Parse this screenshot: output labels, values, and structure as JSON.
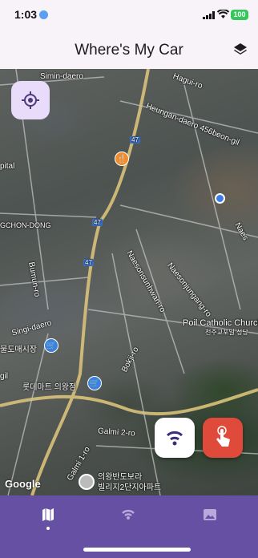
{
  "status_bar": {
    "time": "1:03",
    "battery": "100"
  },
  "app_bar": {
    "title": "Where's My Car",
    "action_icon": "layers-icon"
  },
  "map": {
    "labels": [
      {
        "text": "Simin-daero",
        "name": "street-label-simin-daero"
      },
      {
        "text": "Hagui-ro",
        "name": "street-label-hagui-ro"
      },
      {
        "text": "Heungan-daero 456beon-gil",
        "name": "street-label-heungan-daero"
      },
      {
        "text": "pital",
        "name": "place-label-hospital"
      },
      {
        "text": "GCHON-DONG",
        "name": "area-label-gchon-dong"
      },
      {
        "text": "Naesonjungang-ro",
        "name": "street-label-naesonjungang-ro"
      },
      {
        "text": "Naesonsunhwan-ro",
        "name": "street-label-naesonsunhwan-ro"
      },
      {
        "text": "Bumun-ro",
        "name": "street-label-bumun-ro"
      },
      {
        "text": "Singi-daero",
        "name": "street-label-singi-daero"
      },
      {
        "text": "Poil Catholic Church",
        "name": "place-label-poil-catholic-church"
      },
      {
        "text": "천주교포일 성당",
        "name": "place-label-church-korean"
      },
      {
        "text": "물도매시장",
        "name": "place-label-wholesale-market"
      },
      {
        "text": "롯데마트 의왕점",
        "name": "place-label-lotte-mart"
      },
      {
        "text": "Bokji-ro",
        "name": "street-label-bokji-ro"
      },
      {
        "text": "Galmi 2-ro",
        "name": "street-label-galmi-2-ro"
      },
      {
        "text": "Galmi 1-ro",
        "name": "street-label-galmi-1-ro"
      },
      {
        "text": "의왕반도보라",
        "name": "place-label-apartment-line1"
      },
      {
        "text": "빌리지2단지아파트",
        "name": "place-label-apartment-line2"
      },
      {
        "text": "Naes",
        "name": "street-label-naes"
      },
      {
        "text": "gil",
        "name": "street-label-gil"
      },
      {
        "text": "47",
        "name": "route-shield-47-a"
      },
      {
        "text": "47",
        "name": "route-shield-47-b"
      },
      {
        "text": "47",
        "name": "route-shield-47-c"
      }
    ],
    "attribution": "Google",
    "pins": [
      {
        "name": "restaurant-pin",
        "icon": "fork-knife-icon",
        "color": "#f28b2a"
      },
      {
        "name": "shopping-pin-market",
        "icon": "cart-icon",
        "color": "#3b82e0"
      },
      {
        "name": "shopping-pin-lotte",
        "icon": "cart-icon",
        "color": "#3b82e0"
      },
      {
        "name": "user-location-dot",
        "icon": "location-dot-icon",
        "color": "#3b7de8"
      }
    ]
  },
  "buttons": {
    "locate": {
      "icon": "my-location-icon",
      "color": "#e9dcfb"
    },
    "wifi": {
      "icon": "wifi-icon"
    },
    "tap": {
      "icon": "tap-hand-icon",
      "color": "#df4a3a"
    }
  },
  "bottom_nav": {
    "items": [
      {
        "name": "nav-map",
        "icon": "map-icon",
        "selected": true
      },
      {
        "name": "nav-signal",
        "icon": "signal-icon",
        "selected": false
      },
      {
        "name": "nav-photos",
        "icon": "image-icon",
        "selected": false
      }
    ],
    "color": "#6650a4"
  }
}
